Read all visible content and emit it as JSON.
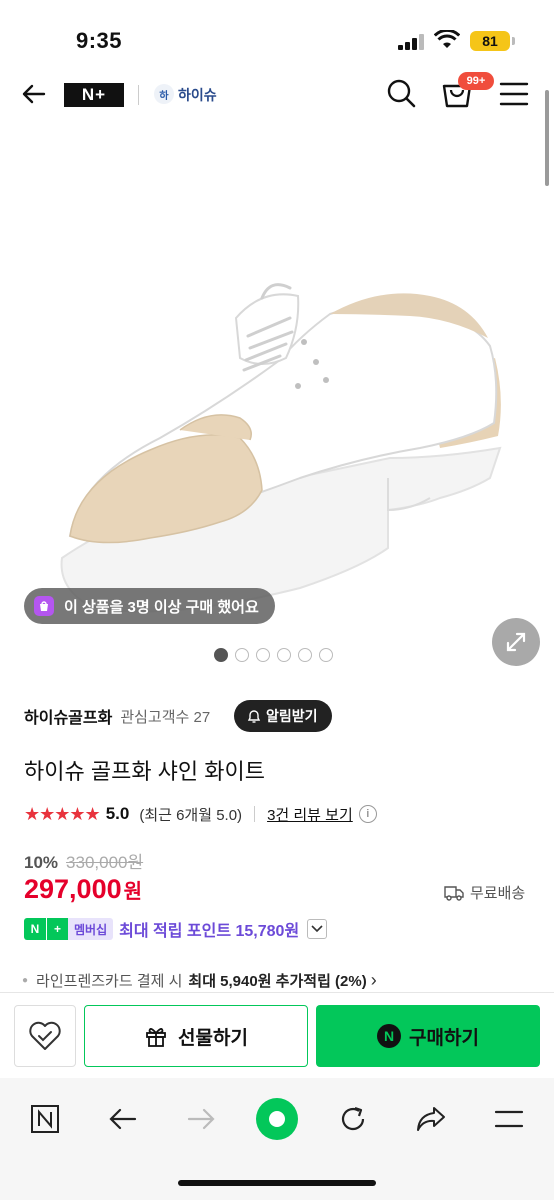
{
  "status_bar": {
    "time": "9:35",
    "battery": "81"
  },
  "header": {
    "logo_text": "N+",
    "brand_badge": "하",
    "brand_name": "하이슈",
    "cart_count": "99+"
  },
  "gallery": {
    "buyers_notice": "이 상품을 3명 이상 구매 했어요",
    "image_count": 6,
    "active_index": 0
  },
  "product": {
    "seller": "하이슈골프화",
    "fav_label": "관심고객수 27",
    "alarm_label": "알림받기",
    "title": "하이슈 골프화 샤인 화이트",
    "stars": "★★★★★",
    "rating": "5.0",
    "rating_recent": "(최근 6개월 5.0)",
    "review_link": "3건 리뷰 보기",
    "info_icon": "i",
    "discount": "10%",
    "original_price": "330,000원",
    "sale_price": "297,000",
    "currency": "원",
    "delivery": "무료배송"
  },
  "points": {
    "badge_n": "N",
    "badge_plus": "+",
    "badge_member": "멤버십",
    "text": "최대 적립 포인트 15,780원"
  },
  "card_benefit": {
    "prefix": "라인프렌즈카드 결제 시",
    "highlight": "최대 5,940원 추가적립 (2%)",
    "chevron": "›"
  },
  "actions": {
    "gift_label": "선물하기",
    "buy_logo": "N",
    "buy_label": "구매하기"
  },
  "browser_toolbar": {
    "items": [
      "home-n-icon",
      "back-arrow-icon",
      "forward-arrow-icon",
      "green-dot-icon",
      "reload-icon",
      "share-icon",
      "menu-icon"
    ]
  },
  "colors": {
    "accent_green": "#03c75a",
    "price_red": "#e5002b",
    "star_red": "#e8333d",
    "points_purple": "#6c4ad8"
  }
}
